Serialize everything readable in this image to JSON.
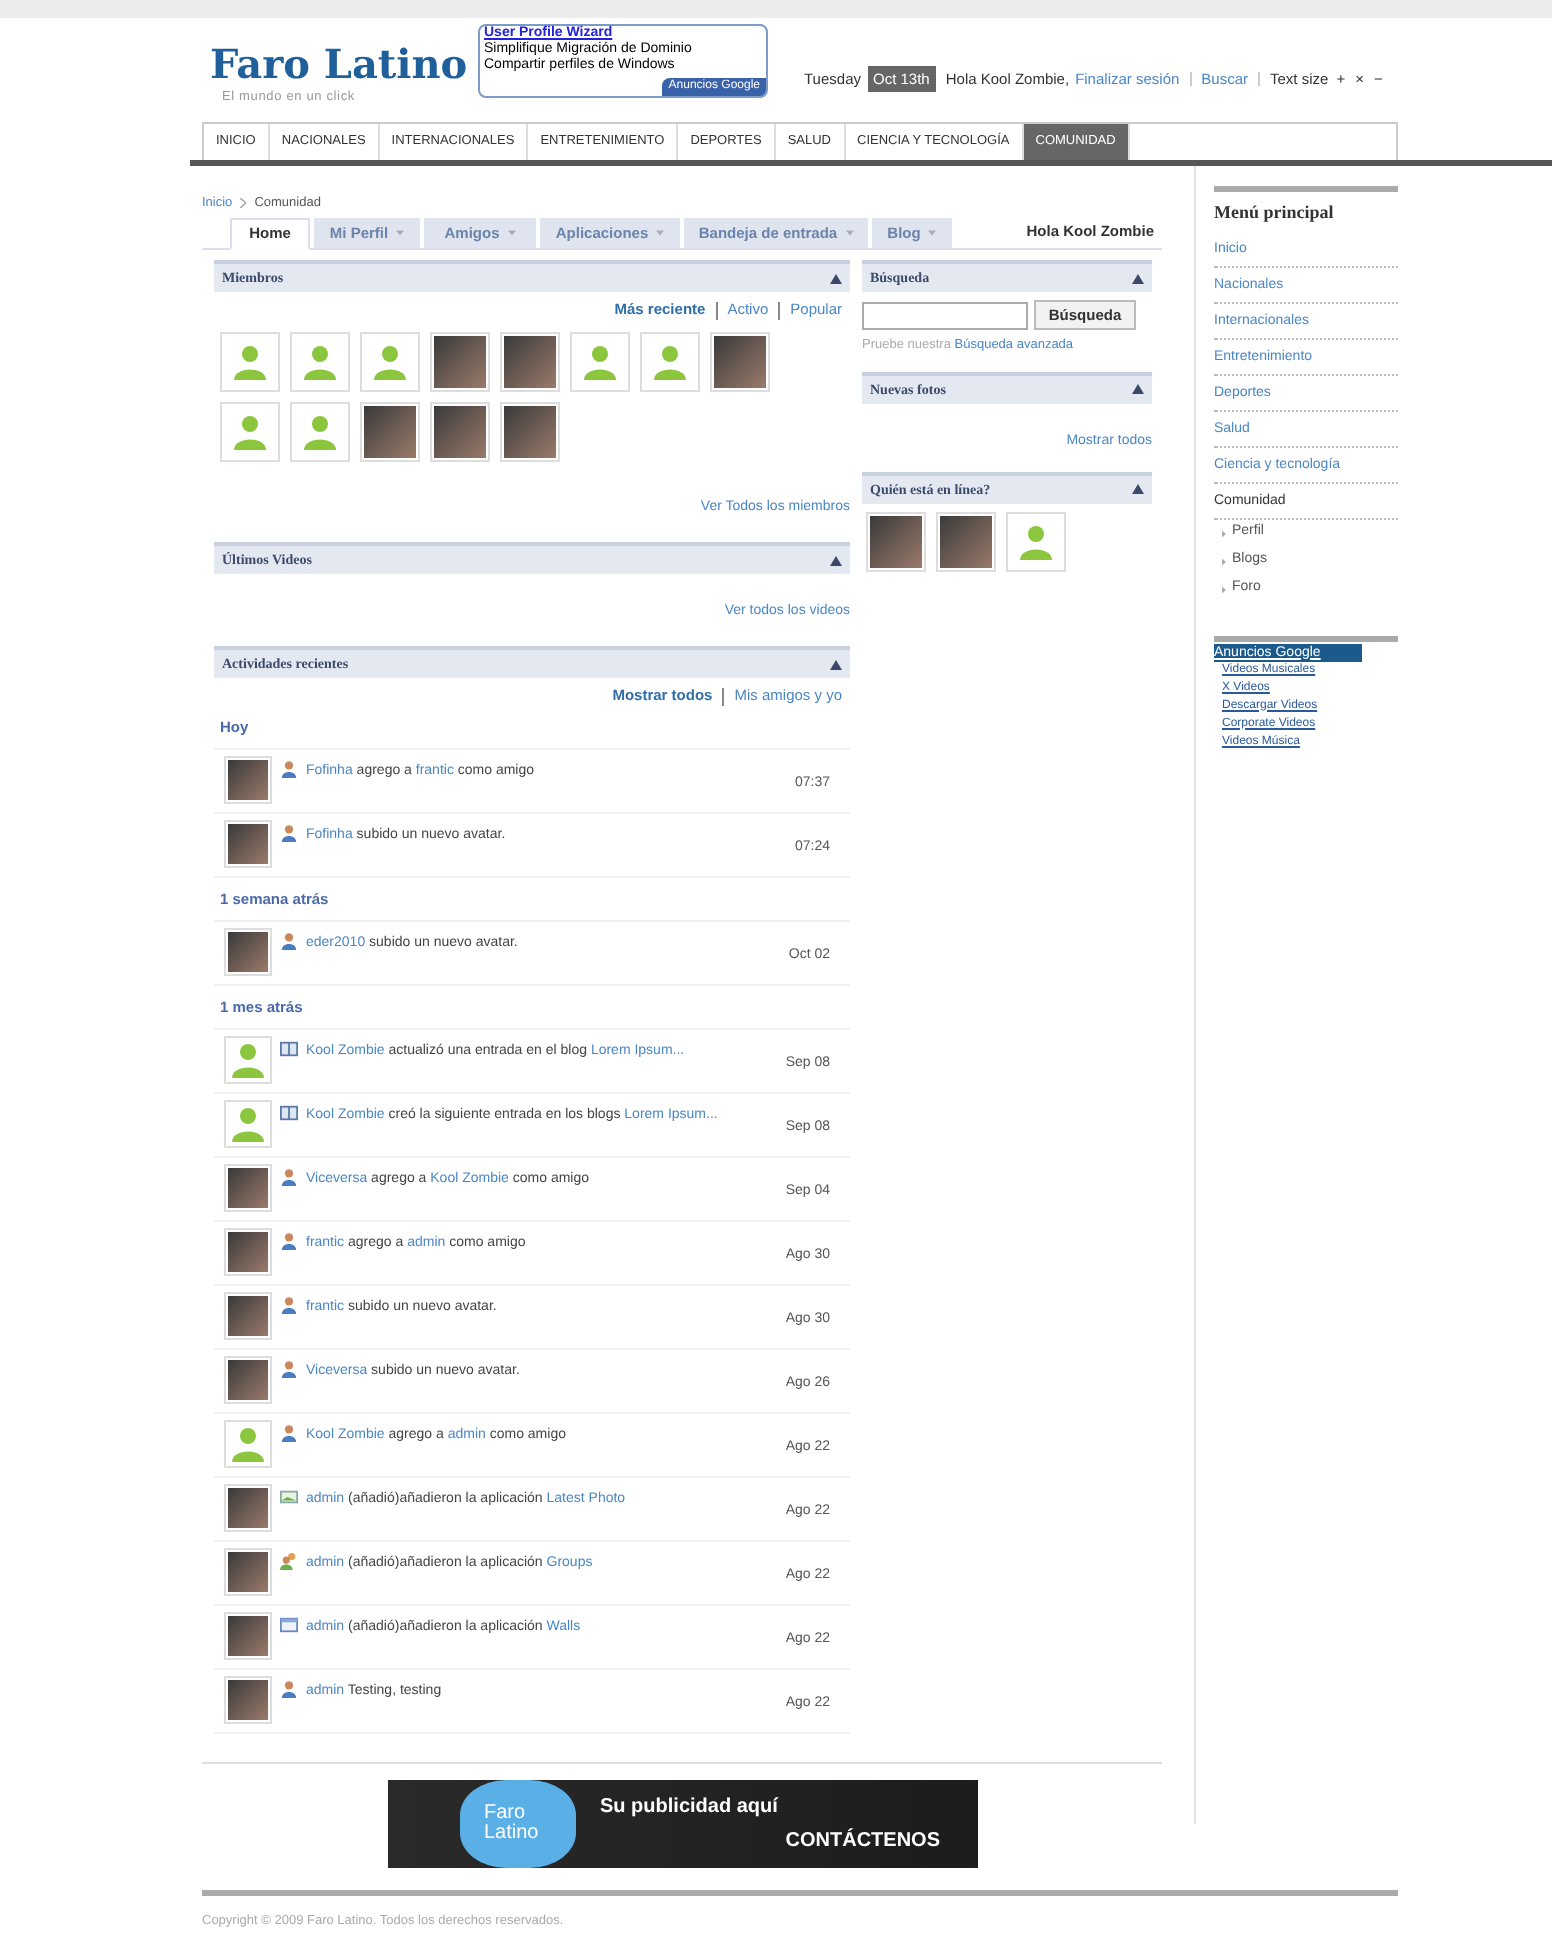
{
  "header": {
    "logo": "Faro Latino",
    "tagline": "El mundo en un click",
    "ad": {
      "title": "User Profile Wizard",
      "lines": [
        "Simplifique Migración de Dominio",
        "Compartir perfiles de Windows"
      ],
      "badge": "Anuncios Google"
    },
    "day": "Tuesday",
    "date": "Oct 13th",
    "greeting": "Hola Kool Zombie,",
    "logout": "Finalizar sesión",
    "search": "Buscar",
    "text_size": "Text size",
    "size_controls": [
      "+",
      "×",
      "−"
    ]
  },
  "nav": [
    {
      "label": "INICIO",
      "selected": false
    },
    {
      "label": "NACIONALES",
      "selected": false
    },
    {
      "label": "INTERNACIONALES",
      "selected": false
    },
    {
      "label": "ENTRETENIMIENTO",
      "selected": false
    },
    {
      "label": "DEPORTES",
      "selected": false
    },
    {
      "label": "SALUD",
      "selected": false
    },
    {
      "label": "CIENCIA Y TECNOLOGÍA",
      "selected": false
    },
    {
      "label": "COMUNIDAD",
      "selected": true
    }
  ],
  "breadcrumb": [
    "Inicio",
    "Comunidad"
  ],
  "tabs": [
    {
      "label": "Home",
      "selected": true,
      "menu": false
    },
    {
      "label": "Mi Perfil",
      "selected": false,
      "menu": true
    },
    {
      "label": "Amigos",
      "selected": false,
      "menu": true
    },
    {
      "label": "Aplicaciones",
      "selected": false,
      "menu": true
    },
    {
      "label": "Bandeja de entrada",
      "selected": false,
      "menu": true
    },
    {
      "label": "Blog",
      "selected": false,
      "menu": true
    }
  ],
  "tabs_greeting": "Hola Kool Zombie",
  "members": {
    "title": "Miembros",
    "filters": [
      {
        "label": "Más reciente",
        "selected": true
      },
      {
        "label": "Activo",
        "selected": false
      },
      {
        "label": "Popular",
        "selected": false
      }
    ],
    "avatars": [
      {
        "kind": "default"
      },
      {
        "kind": "default"
      },
      {
        "kind": "default"
      },
      {
        "kind": "photo"
      },
      {
        "kind": "photo"
      },
      {
        "kind": "default"
      },
      {
        "kind": "default"
      },
      {
        "kind": "photo"
      },
      {
        "kind": "default"
      },
      {
        "kind": "default"
      },
      {
        "kind": "photo"
      },
      {
        "kind": "photo"
      },
      {
        "kind": "photo"
      }
    ],
    "more": "Ver Todos los miembros"
  },
  "videos": {
    "title": "Últimos Videos",
    "more": "Ver todos los videos"
  },
  "activity": {
    "title": "Actividades recientes",
    "filters": [
      {
        "label": "Mostrar todos",
        "selected": true
      },
      {
        "label": "Mis amigos y yo",
        "selected": false
      }
    ],
    "groups": [
      {
        "label": "Hoy",
        "items": [
          {
            "avatar": {
              "kind": "photo"
            },
            "kind": "user",
            "parts": [
              {
                "text": "Fofinha",
                "link": true
              },
              {
                "text": " agrego a ",
                "link": false
              },
              {
                "text": "frantic",
                "link": true
              },
              {
                "text": " como amigo",
                "link": false
              }
            ],
            "time": "07:37"
          },
          {
            "avatar": {
              "kind": "photo"
            },
            "kind": "user",
            "parts": [
              {
                "text": "Fofinha",
                "link": true
              },
              {
                "text": " subido un nuevo avatar.",
                "link": false
              }
            ],
            "time": "07:24"
          }
        ]
      },
      {
        "label": "1 semana atrás",
        "items": [
          {
            "avatar": {
              "kind": "photo"
            },
            "kind": "user",
            "parts": [
              {
                "text": "eder2010",
                "link": true
              },
              {
                "text": " subido un nuevo avatar.",
                "link": false
              }
            ],
            "time": "Oct 02"
          }
        ]
      },
      {
        "label": "1 mes atrás",
        "items": [
          {
            "avatar": {
              "kind": "default"
            },
            "kind": "blog",
            "parts": [
              {
                "text": "Kool Zombie",
                "link": true
              },
              {
                "text": " actualizó una entrada en el blog ",
                "link": false
              },
              {
                "text": "Lorem Ipsum...",
                "link": true
              }
            ],
            "time": "Sep 08"
          },
          {
            "avatar": {
              "kind": "default"
            },
            "kind": "blog",
            "parts": [
              {
                "text": "Kool Zombie",
                "link": true
              },
              {
                "text": " creó la siguiente entrada en los blogs ",
                "link": false
              },
              {
                "text": "Lorem Ipsum...",
                "link": true
              }
            ],
            "time": "Sep 08"
          },
          {
            "avatar": {
              "kind": "photo"
            },
            "kind": "user",
            "parts": [
              {
                "text": "Viceversa",
                "link": true
              },
              {
                "text": " agrego a ",
                "link": false
              },
              {
                "text": "Kool Zombie",
                "link": true
              },
              {
                "text": " como amigo",
                "link": false
              }
            ],
            "time": "Sep 04"
          },
          {
            "avatar": {
              "kind": "photo"
            },
            "kind": "user",
            "parts": [
              {
                "text": "frantic",
                "link": true
              },
              {
                "text": " agrego a ",
                "link": false
              },
              {
                "text": "admin",
                "link": true
              },
              {
                "text": " como amigo",
                "link": false
              }
            ],
            "time": "Ago 30"
          },
          {
            "avatar": {
              "kind": "photo"
            },
            "kind": "user",
            "parts": [
              {
                "text": "frantic",
                "link": true
              },
              {
                "text": " subido un nuevo avatar.",
                "link": false
              }
            ],
            "time": "Ago 30"
          },
          {
            "avatar": {
              "kind": "photo"
            },
            "kind": "user",
            "parts": [
              {
                "text": "Viceversa",
                "link": true
              },
              {
                "text": " subido un nuevo avatar.",
                "link": false
              }
            ],
            "time": "Ago 26"
          },
          {
            "avatar": {
              "kind": "default"
            },
            "kind": "user",
            "parts": [
              {
                "text": "Kool Zombie",
                "link": true
              },
              {
                "text": " agrego a ",
                "link": false
              },
              {
                "text": "admin",
                "link": true
              },
              {
                "text": " como amigo",
                "link": false
              }
            ],
            "time": "Ago 22"
          },
          {
            "avatar": {
              "kind": "photo"
            },
            "kind": "photo",
            "parts": [
              {
                "text": "admin",
                "link": true
              },
              {
                "text": " (añadió)añadieron la aplicación ",
                "link": false
              },
              {
                "text": "Latest Photo",
                "link": true
              }
            ],
            "time": "Ago 22"
          },
          {
            "avatar": {
              "kind": "photo"
            },
            "kind": "group",
            "parts": [
              {
                "text": "admin",
                "link": true
              },
              {
                "text": " (añadió)añadieron la aplicación ",
                "link": false
              },
              {
                "text": "Groups",
                "link": true
              }
            ],
            "time": "Ago 22"
          },
          {
            "avatar": {
              "kind": "photo"
            },
            "kind": "wall",
            "parts": [
              {
                "text": "admin",
                "link": true
              },
              {
                "text": " (añadió)añadieron la aplicación ",
                "link": false
              },
              {
                "text": "Walls",
                "link": true
              }
            ],
            "time": "Ago 22"
          },
          {
            "avatar": {
              "kind": "photo"
            },
            "kind": "user",
            "parts": [
              {
                "text": "admin",
                "link": true
              },
              {
                "text": " Testing, testing",
                "link": false
              }
            ],
            "time": "Ago 22"
          }
        ]
      }
    ]
  },
  "search": {
    "title": "Búsqueda",
    "button": "Búsqueda",
    "hint": "Pruebe nuestra",
    "hint_link": "Búsqueda avanzada"
  },
  "photos": {
    "title": "Nuevas fotos",
    "more": "Mostrar todos"
  },
  "online": {
    "title": "Quién está en línea?",
    "avatars": [
      {
        "kind": "photo"
      },
      {
        "kind": "photo"
      },
      {
        "kind": "default"
      }
    ]
  },
  "sidebar": {
    "title": "Menú principal",
    "items": [
      {
        "label": "Inicio",
        "selected": false
      },
      {
        "label": "Nacionales",
        "selected": false
      },
      {
        "label": "Internacionales",
        "selected": false
      },
      {
        "label": "Entretenimiento",
        "selected": false
      },
      {
        "label": "Deportes",
        "selected": false
      },
      {
        "label": "Salud",
        "selected": false
      },
      {
        "label": "Ciencia y tecnología",
        "selected": false
      },
      {
        "label": "Comunidad",
        "selected": true,
        "children": [
          {
            "label": "Perfil"
          },
          {
            "label": "Blogs"
          },
          {
            "label": "Foro"
          }
        ]
      }
    ]
  },
  "ads": {
    "title": "Anuncios Google",
    "links": [
      "Videos Musicales",
      "X Videos",
      "Descargar Videos",
      "Corporate Videos",
      "Videos Música"
    ]
  },
  "banner": {
    "logo_lines": [
      "Faro",
      "Latino"
    ],
    "headline": "Su publicidad aquí",
    "cta": "CONTÁCTENOS"
  },
  "copyright": "Copyright © 2009 Faro Latino. Todos los derechos reservados."
}
